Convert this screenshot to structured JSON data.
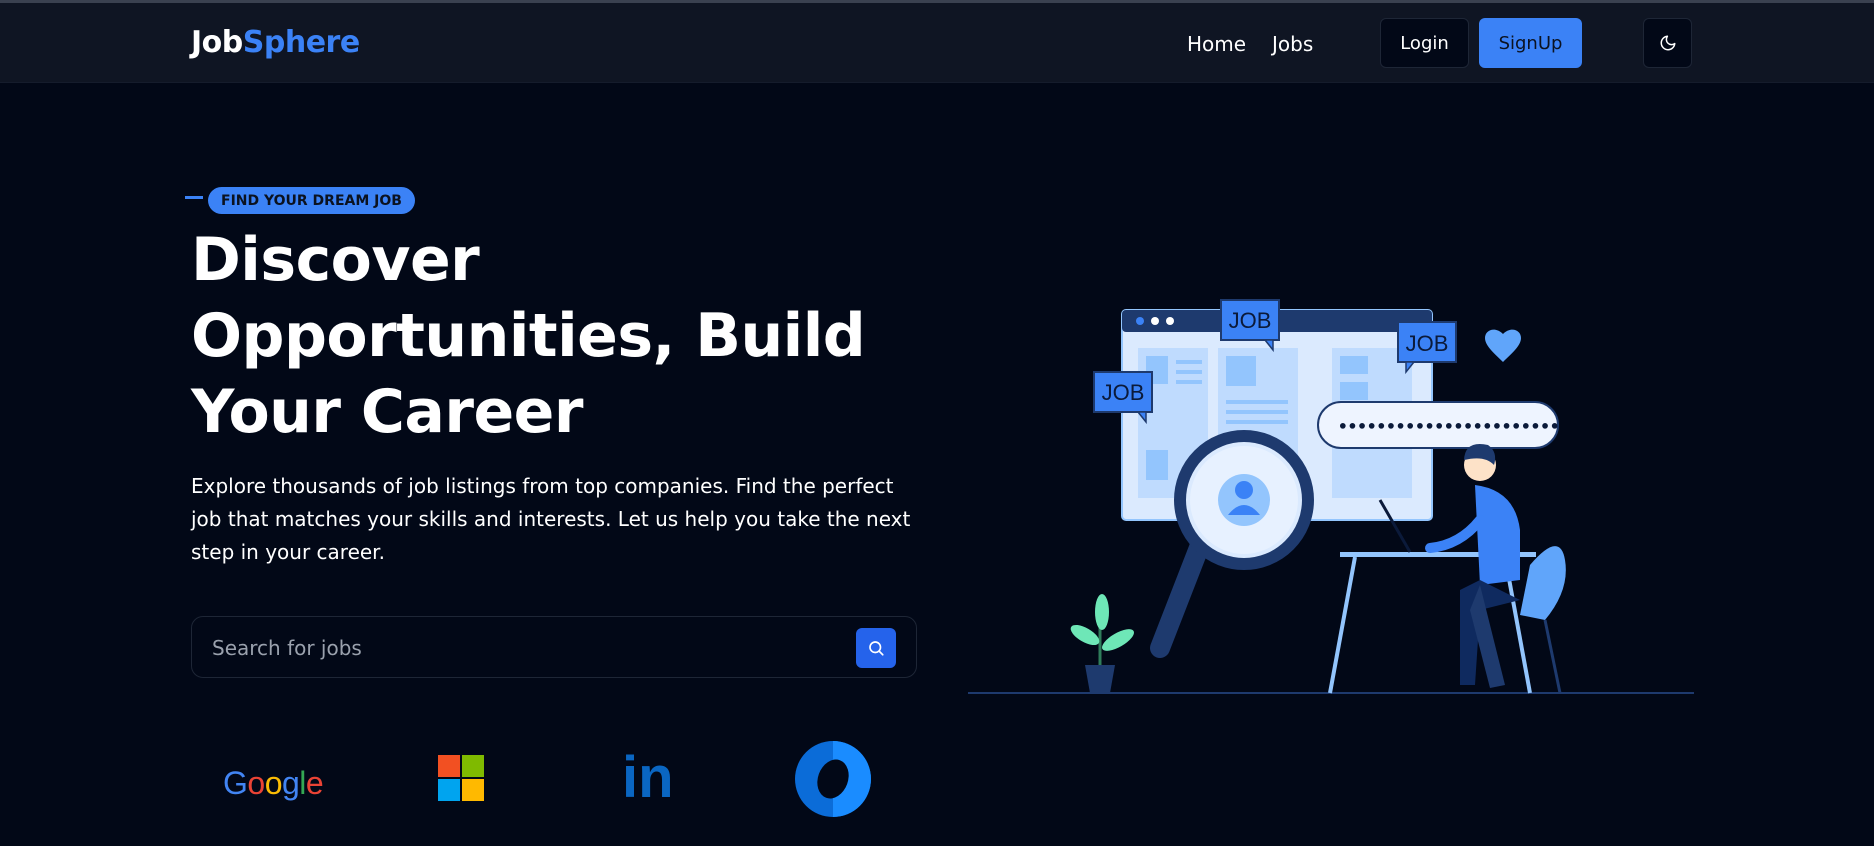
{
  "brand": {
    "part1": "Job",
    "part2": "Sphere"
  },
  "nav": {
    "links": [
      {
        "label": "Home"
      },
      {
        "label": "Jobs"
      }
    ],
    "login_label": "Login",
    "signup_label": "SignUp",
    "theme_icon": "moon-icon"
  },
  "hero": {
    "badge": "FIND YOUR DREAM JOB",
    "title_lines": [
      "Discover",
      "Opportunities, Build",
      "Your Career"
    ],
    "description": "Explore thousands of job listings from top companies. Find the perfect job that matches your skills and interests. Let us help you take the next step in your career.",
    "search_placeholder": "Search for jobs",
    "search_icon": "search-icon"
  },
  "illustration": {
    "tags": [
      "JOB",
      "JOB",
      "JOB"
    ],
    "search_dots": "•••••••••••••••••••••••"
  },
  "company_logos": [
    {
      "name": "google-logo",
      "text": "Google"
    },
    {
      "name": "microsoft-logo",
      "text": ""
    },
    {
      "name": "linkedin-logo",
      "text": "in"
    },
    {
      "name": "company-logo-circle",
      "text": ""
    }
  ],
  "colors": {
    "background": "#020817",
    "navbar": "#0f1523",
    "accent": "#3b82f6",
    "accent_dark": "#2563eb",
    "text": "#ffffff",
    "muted": "#9aa1ad"
  }
}
